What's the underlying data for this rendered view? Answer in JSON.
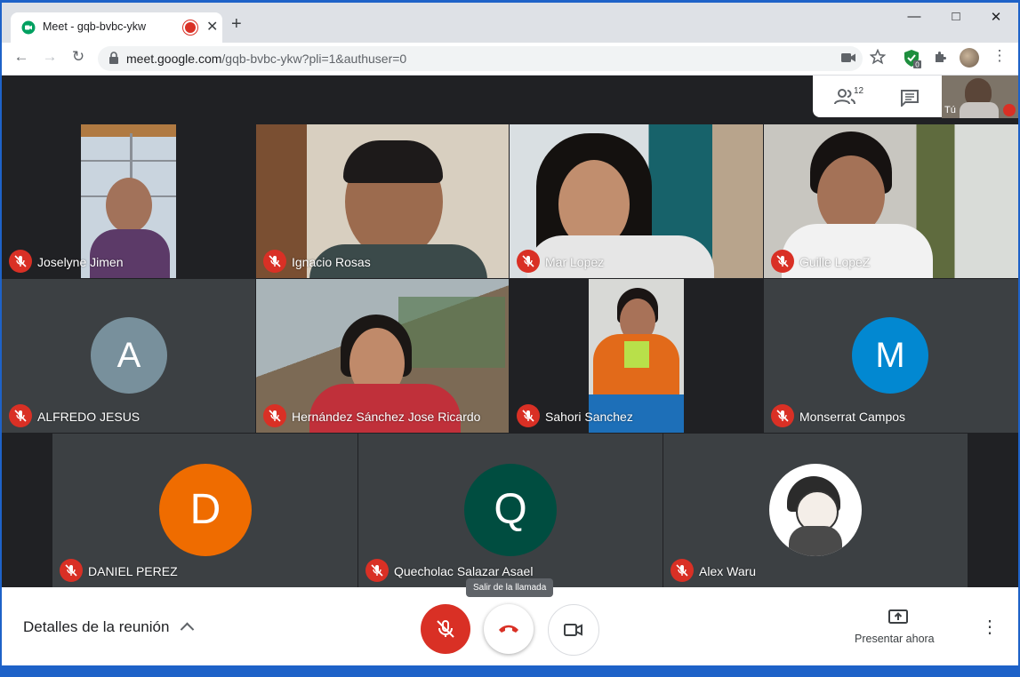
{
  "browser": {
    "tab_title": "Meet - gqb-bvbc-ykw",
    "url_host": "meet.google.com",
    "url_path": "/gqb-bvbc-ykw?pli=1&authuser=0",
    "extension_badge": "0"
  },
  "meet": {
    "participants_count": "12",
    "self_label": "Tú",
    "tooltip": "Salir de la llamada",
    "meeting_details": "Detalles de la reunión",
    "present_now": "Presentar ahora"
  },
  "participants": [
    {
      "name": "Joselyne Jimen",
      "type": "video"
    },
    {
      "name": "Ignacio Rosas",
      "type": "video"
    },
    {
      "name": "Mar Lopez",
      "type": "video"
    },
    {
      "name": "Guille LopeZ",
      "type": "video"
    },
    {
      "name": "ALFREDO JESUS",
      "type": "avatar",
      "initial": "A",
      "color": "#78909c"
    },
    {
      "name": "Hernández Sánchez Jose Ricardo",
      "type": "video"
    },
    {
      "name": "Sahori Sanchez",
      "type": "video"
    },
    {
      "name": "Monserrat Campos",
      "type": "avatar",
      "initial": "M",
      "color": "#0288d1"
    },
    {
      "name": "DANIEL PEREZ",
      "type": "avatar",
      "initial": "D",
      "color": "#ef6c00"
    },
    {
      "name": "Quecholac Salazar Asael",
      "type": "avatar",
      "initial": "Q",
      "color": "#004d40"
    },
    {
      "name": "Alex Waru",
      "type": "avatar-image"
    }
  ],
  "colors": {
    "meet_bg": "#202124",
    "mic_muted": "#d93025",
    "hangup": "#d93025"
  }
}
